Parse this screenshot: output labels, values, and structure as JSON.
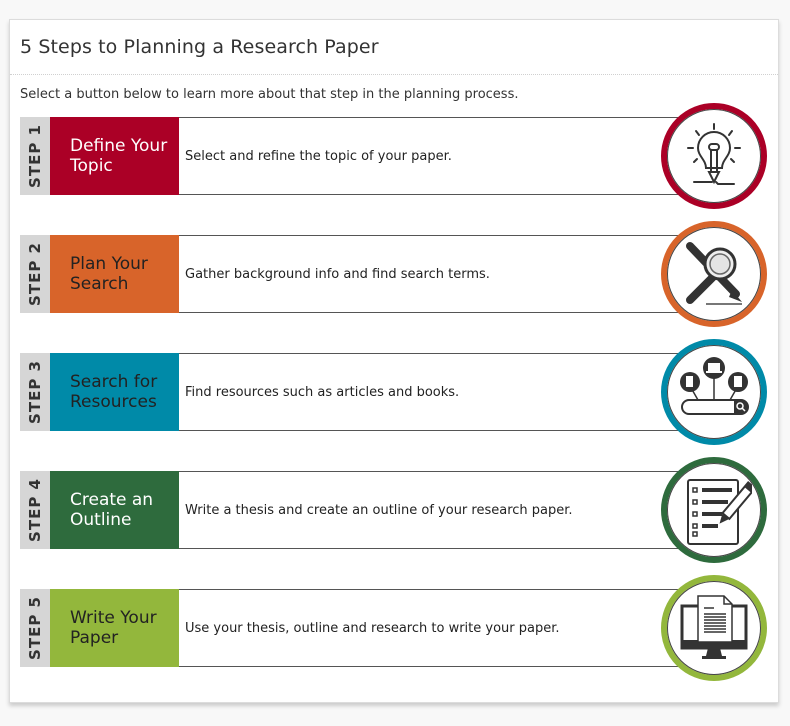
{
  "header": {
    "title": "5 Steps to Planning a Research Paper",
    "intro": "Select a button below to learn more about that step in the planning process."
  },
  "steps": [
    {
      "step_label": "STEP 1",
      "title_line1": "Define Your",
      "title_line2": "Topic",
      "description": "Select and refine the topic of your paper.",
      "color": "#ab0026",
      "title_color": "#ffffff",
      "icon": "lightbulb-pencil-icon"
    },
    {
      "step_label": "STEP 2",
      "title_line1": "Plan Your",
      "title_line2": "Search",
      "description": "Gather background info and find search terms.",
      "color": "#d8642a",
      "title_color": "#222222",
      "icon": "magnifier-pencil-icon"
    },
    {
      "step_label": "STEP 3",
      "title_line1": "Search for",
      "title_line2": "Resources",
      "description": "Find resources such as articles and books.",
      "color": "#008aa8",
      "title_color": "#222222",
      "icon": "search-resources-icon"
    },
    {
      "step_label": "STEP 4",
      "title_line1": "Create an",
      "title_line2": "Outline",
      "description": "Write a thesis and create an outline of your research paper.",
      "color": "#2e6b3d",
      "title_color": "#ffffff",
      "icon": "checklist-pencil-icon"
    },
    {
      "step_label": "STEP 5",
      "title_line1": "Write Your",
      "title_line2": "Paper",
      "description": "Use your thesis, outline and research to write your paper.",
      "color": "#93b73c",
      "title_color": "#222222",
      "icon": "monitor-document-icon"
    }
  ]
}
